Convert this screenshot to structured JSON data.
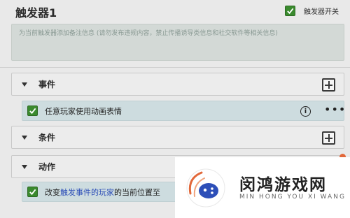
{
  "header": {
    "title": "触发器1",
    "toggle_label": "触发器开关",
    "toggle_checked": true
  },
  "note": {
    "placeholder": "为当前触发器添加备注信息 (请勿发布违规内容，禁止传播诱导类信息和社交软件等相关信息)"
  },
  "sections": {
    "events": {
      "label": "事件"
    },
    "conditions": {
      "label": "条件"
    },
    "actions": {
      "label": "动作"
    }
  },
  "event_item": {
    "text": "任意玩家使用动画表情",
    "checked": true
  },
  "action_item": {
    "prefix": "改变",
    "highlight1": "触发事件的玩家",
    "middle": "的当前位置至",
    "checked": true
  },
  "watermark": {
    "name": "闵鸿游戏网",
    "pinyin": "MIN HONG YOU XI WANG"
  },
  "colors": {
    "checkbox_green": "#3a8a2e",
    "item_bg": "#cddcdf",
    "highlight_blue": "#2d4fb8",
    "badge_orange": "#e2683a"
  }
}
